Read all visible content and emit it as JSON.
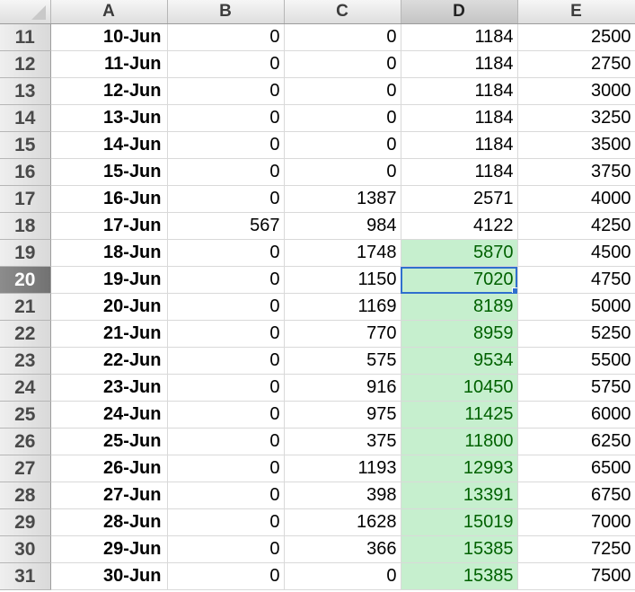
{
  "columns": [
    "A",
    "B",
    "C",
    "D",
    "E"
  ],
  "selected_column": "D",
  "selected_row": 20,
  "highlight": {
    "column": "D",
    "from_row": 19,
    "fill_color": "#c6efce",
    "text_color": "#006100"
  },
  "rows": [
    {
      "row": "11",
      "A": "10-Jun",
      "B": "0",
      "C": "0",
      "D": "1184",
      "E": "2500"
    },
    {
      "row": "12",
      "A": "11-Jun",
      "B": "0",
      "C": "0",
      "D": "1184",
      "E": "2750"
    },
    {
      "row": "13",
      "A": "12-Jun",
      "B": "0",
      "C": "0",
      "D": "1184",
      "E": "3000"
    },
    {
      "row": "14",
      "A": "13-Jun",
      "B": "0",
      "C": "0",
      "D": "1184",
      "E": "3250"
    },
    {
      "row": "15",
      "A": "14-Jun",
      "B": "0",
      "C": "0",
      "D": "1184",
      "E": "3500"
    },
    {
      "row": "16",
      "A": "15-Jun",
      "B": "0",
      "C": "0",
      "D": "1184",
      "E": "3750"
    },
    {
      "row": "17",
      "A": "16-Jun",
      "B": "0",
      "C": "1387",
      "D": "2571",
      "E": "4000"
    },
    {
      "row": "18",
      "A": "17-Jun",
      "B": "567",
      "C": "984",
      "D": "4122",
      "E": "4250"
    },
    {
      "row": "19",
      "A": "18-Jun",
      "B": "0",
      "C": "1748",
      "D": "5870",
      "E": "4500"
    },
    {
      "row": "20",
      "A": "19-Jun",
      "B": "0",
      "C": "1150",
      "D": "7020",
      "E": "4750"
    },
    {
      "row": "21",
      "A": "20-Jun",
      "B": "0",
      "C": "1169",
      "D": "8189",
      "E": "5000"
    },
    {
      "row": "22",
      "A": "21-Jun",
      "B": "0",
      "C": "770",
      "D": "8959",
      "E": "5250"
    },
    {
      "row": "23",
      "A": "22-Jun",
      "B": "0",
      "C": "575",
      "D": "9534",
      "E": "5500"
    },
    {
      "row": "24",
      "A": "23-Jun",
      "B": "0",
      "C": "916",
      "D": "10450",
      "E": "5750"
    },
    {
      "row": "25",
      "A": "24-Jun",
      "B": "0",
      "C": "975",
      "D": "11425",
      "E": "6000"
    },
    {
      "row": "26",
      "A": "25-Jun",
      "B": "0",
      "C": "375",
      "D": "11800",
      "E": "6250"
    },
    {
      "row": "27",
      "A": "26-Jun",
      "B": "0",
      "C": "1193",
      "D": "12993",
      "E": "6500"
    },
    {
      "row": "28",
      "A": "27-Jun",
      "B": "0",
      "C": "398",
      "D": "13391",
      "E": "6750"
    },
    {
      "row": "29",
      "A": "28-Jun",
      "B": "0",
      "C": "1628",
      "D": "15019",
      "E": "7000"
    },
    {
      "row": "30",
      "A": "29-Jun",
      "B": "0",
      "C": "366",
      "D": "15385",
      "E": "7250"
    },
    {
      "row": "31",
      "A": "30-Jun",
      "B": "0",
      "C": "0",
      "D": "15385",
      "E": "7500"
    }
  ]
}
